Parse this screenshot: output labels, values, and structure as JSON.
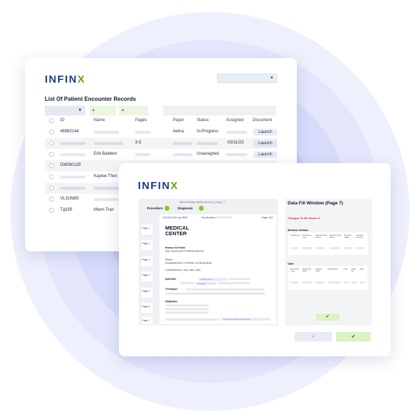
{
  "brand": {
    "logo_main": "INFIN",
    "logo_x": "X"
  },
  "records_window": {
    "title": "List Of Patient Encounter Records",
    "filter_add_1": "+",
    "filter_add_2": "+",
    "columns": [
      "ID",
      "Name",
      "Pages",
      "Payer",
      "Status",
      "Assigned",
      "Document"
    ],
    "rows": [
      {
        "id": "46982144",
        "name": "",
        "pages": "",
        "payer": "Aetna",
        "status": "In-Progress",
        "assigned": "",
        "document": "Launch"
      },
      {
        "id": "",
        "name": "",
        "pages": "3-5",
        "payer": "",
        "status": "",
        "assigned": "03/11/23",
        "document": "Launch"
      },
      {
        "id": "",
        "name": "Erik Baldwin",
        "pages": "",
        "payer": "",
        "status": "Unassigned",
        "assigned": "",
        "document": "Launch"
      },
      {
        "id": "DM090129",
        "name": "",
        "pages": "",
        "payer": "",
        "status": "",
        "assigned": "",
        "document": ""
      },
      {
        "id": "",
        "name": "Kaylee Thon",
        "pages": "",
        "payer": "",
        "status": "",
        "assigned": "",
        "document": ""
      },
      {
        "id": "",
        "name": "",
        "pages": "",
        "payer": "",
        "status": "",
        "assigned": "",
        "document": ""
      },
      {
        "id": "VL3Ufd95",
        "name": "",
        "pages": "",
        "payer": "",
        "status": "",
        "assigned": "",
        "document": ""
      },
      {
        "id": "Tg339",
        "name": "Mann Tran",
        "pages": "",
        "payer": "",
        "status": "",
        "assigned": "",
        "document": ""
      }
    ]
  },
  "document_window": {
    "document_id": "365472699g-4689b-2bdc7a_Page_7",
    "toggle_procedure": "Procedure",
    "toggle_diagnosis": "Diagnosis",
    "page_header_left": "4/12/23 11:50 am EMR",
    "page_header_mid": "Fax Number:",
    "page_header_right": "Page 1/22",
    "page_tabs": [
      "Page 1",
      "Page 2",
      "Page 3",
      "Page 4",
      "Page 5",
      "Page 6",
      "Page 7"
    ],
    "doc_title_line1": "MEDICAL",
    "doc_title_line2": "CENTER",
    "reason_label": "Reason for Exam",
    "reason_value": "3(4) Thyroid) 69 THYROID BIOPSY",
    "report_label": "Report",
    "exam_label": "EXAMINATION: THYROID ULTRASOUND",
    "comparison_label": "COMPARISON: June 18th, 2021",
    "history_label": "HISTORY:",
    "history_hl_1": "right thyroid",
    "history_hl_2": "enlarged",
    "technique_label": "Technique:",
    "findings_label": "FINDINGS:",
    "findings_hl": "a few tiny cystic components",
    "data_fill_title": "Data Fill Window (Page 7)",
    "changes_text": "Changes To Be Saved: 0",
    "member_details_label": "Member Details",
    "member_columns": [
      "Tracking Id",
      "Encounter Type",
      "Member First Name",
      "Member Last Name",
      "Member DOB",
      "Member Gender"
    ],
    "date_label": "Date",
    "date_columns": [
      "Encounter Type",
      "Reporting DOS",
      "Ending DOS",
      "Description",
      "Type",
      "Page No",
      "Date"
    ],
    "confirm_icon": "✔",
    "down_icon": "↓",
    "save_icon": "✔"
  },
  "icons": {
    "caret": "▾"
  },
  "colors": {
    "brand_navy": "#1e3a8a",
    "brand_green": "#65a30d",
    "toggle_green": "#84cc16",
    "alert_red": "#dc2626"
  }
}
